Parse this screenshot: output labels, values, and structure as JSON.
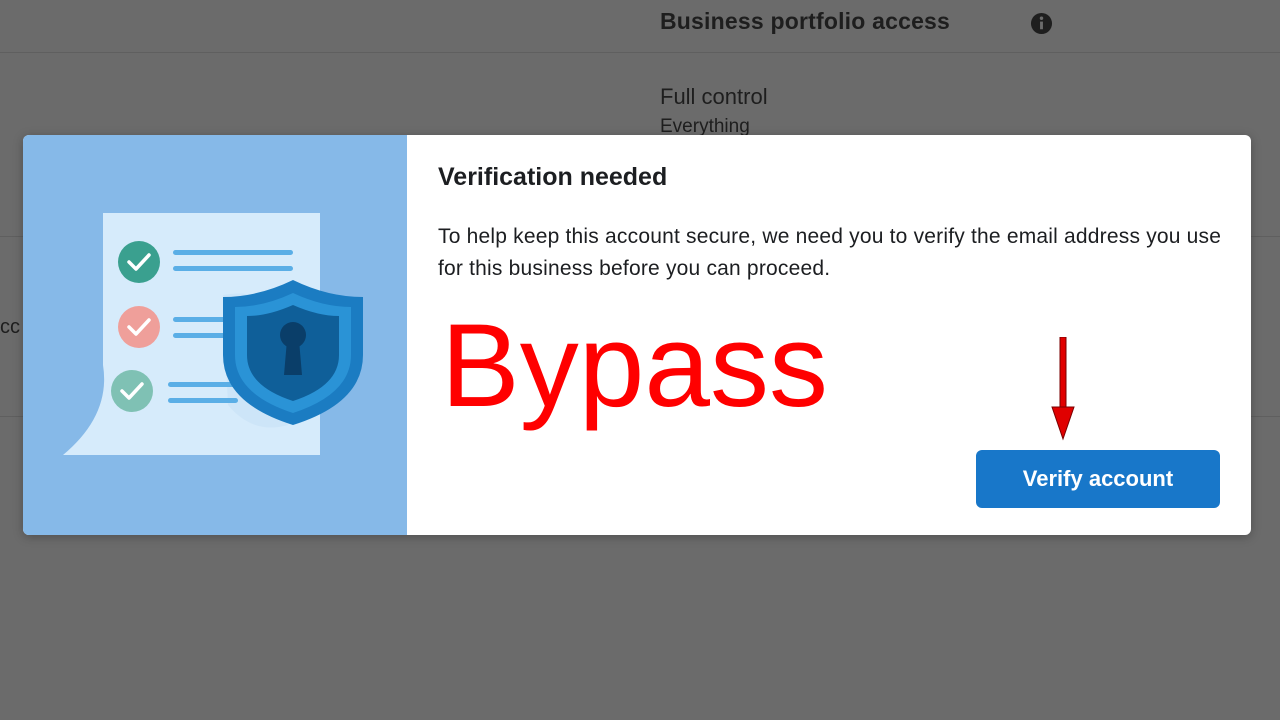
{
  "background": {
    "section_title": "Business portfolio access",
    "permission_title": "Full control",
    "permission_subtitle": "Everything",
    "truncated_label": "cc"
  },
  "modal": {
    "title": "Verification needed",
    "body": "To help keep this account secure, we need you to verify the email address you use for this business before you can proceed.",
    "verify_button_label": "Verify account"
  },
  "overlay": {
    "caption": "Bypass"
  },
  "colors": {
    "backdrop": "#6b6b6b",
    "illustration_bg": "#86b9e8",
    "button": "#1877c9",
    "caption": "#ff0000"
  },
  "icons": [
    "info-icon",
    "document-icon",
    "check-icon",
    "shield-lock-icon",
    "down-arrow-icon"
  ]
}
